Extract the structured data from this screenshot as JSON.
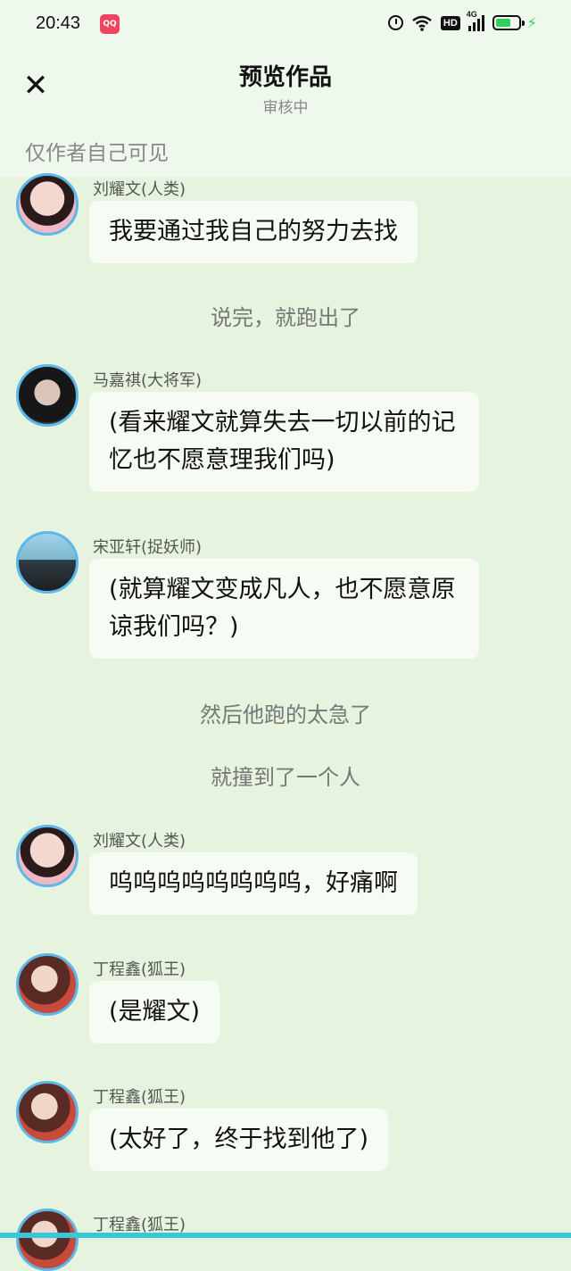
{
  "status_bar": {
    "time": "20:43",
    "app_badge": "QQ",
    "network": "4G",
    "hd": "HD",
    "battery_level": 0.7
  },
  "header": {
    "title": "预览作品",
    "subtitle": "审核中",
    "visibility_note": "仅作者自己可见"
  },
  "messages": [
    {
      "speaker": "刘耀文(人类)",
      "text": "我要通过我自己的努力去找"
    },
    {
      "narration": "说完，就跑出了"
    },
    {
      "speaker": "马嘉祺(大将军)",
      "text": "(看来耀文就算失去一切以前的记忆也不愿意理我们吗)"
    },
    {
      "speaker": "宋亚轩(捉妖师)",
      "text": "(就算耀文变成凡人，也不愿意原谅我们吗？)"
    },
    {
      "narration": "然后他跑的太急了"
    },
    {
      "narration": "就撞到了一个人"
    },
    {
      "speaker": "刘耀文(人类)",
      "text": "呜呜呜呜呜呜呜呜，好痛啊"
    },
    {
      "speaker": "丁程鑫(狐王)",
      "text": "(是耀文)"
    },
    {
      "speaker": "丁程鑫(狐王)",
      "text": "(太好了，终于找到他了)"
    },
    {
      "speaker": "丁程鑫(狐王)",
      "text": ""
    }
  ]
}
